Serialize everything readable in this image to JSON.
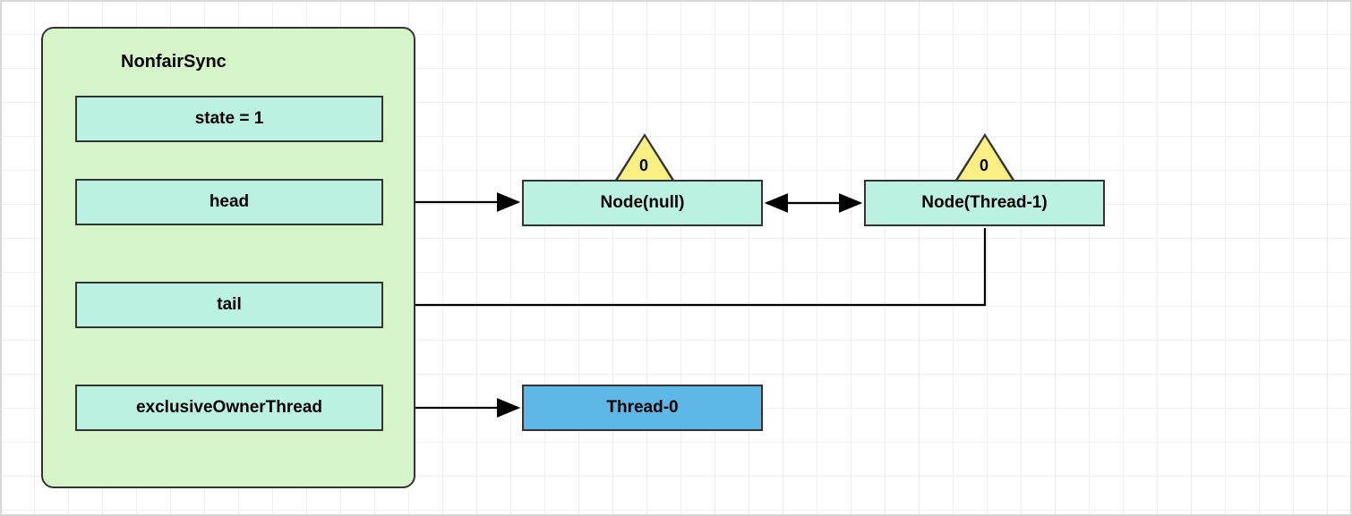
{
  "container": {
    "title": "NonfairSync",
    "fields": {
      "state": "state = 1",
      "head": "head",
      "tail": "tail",
      "owner": "exclusiveOwnerThread"
    }
  },
  "nodes": {
    "null_node": {
      "label": "Node(null)",
      "badge": "0"
    },
    "thread1_node": {
      "label": "Node(Thread-1)",
      "badge": "0"
    }
  },
  "thread0": "Thread-0"
}
